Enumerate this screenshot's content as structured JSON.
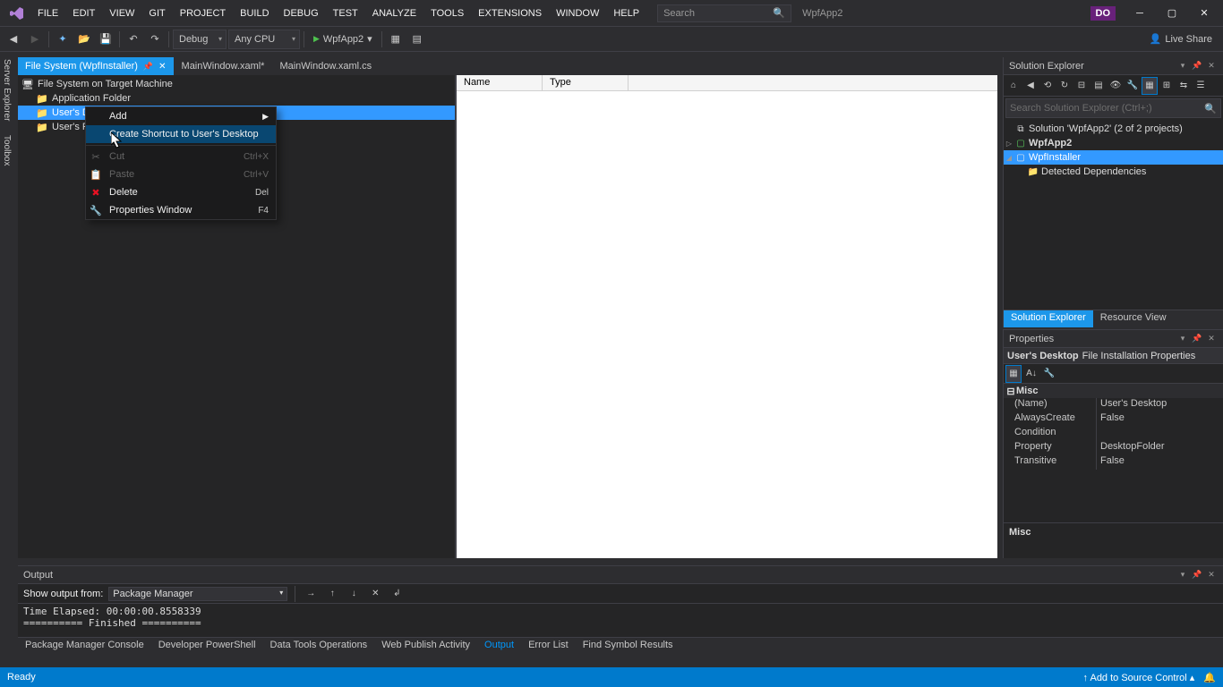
{
  "titlebar": {
    "menu": [
      "FILE",
      "EDIT",
      "VIEW",
      "GIT",
      "PROJECT",
      "BUILD",
      "DEBUG",
      "TEST",
      "ANALYZE",
      "TOOLS",
      "EXTENSIONS",
      "WINDOW",
      "HELP"
    ],
    "search_placeholder": "Search",
    "app_name": "WpfApp2",
    "user_badge": "DO"
  },
  "toolbar": {
    "config": "Debug",
    "platform": "Any CPU",
    "start": "WpfApp2",
    "live_share": "Live Share"
  },
  "tabs": [
    {
      "label": "File System (WpfInstaller)",
      "active": true,
      "pinned": true
    },
    {
      "label": "MainWindow.xaml*",
      "active": false
    },
    {
      "label": "MainWindow.xaml.cs",
      "active": false
    }
  ],
  "filesystem": {
    "root": "File System on Target Machine",
    "items": [
      {
        "label": "Application Folder",
        "indent": 1
      },
      {
        "label": "User's Desktop",
        "indent": 1,
        "selected": true
      },
      {
        "label": "User's Prog",
        "indent": 1
      }
    ]
  },
  "list_cols": [
    "Name",
    "Type"
  ],
  "context_menu": {
    "items": [
      {
        "label": "Add",
        "submenu": true
      },
      {
        "label": "Create Shortcut to User's Desktop",
        "selected": true
      },
      {
        "sep": true
      },
      {
        "label": "Cut",
        "shortcut": "Ctrl+X",
        "disabled": true,
        "icon": "✂"
      },
      {
        "label": "Paste",
        "shortcut": "Ctrl+V",
        "disabled": true,
        "icon": "📋"
      },
      {
        "label": "Delete",
        "shortcut": "Del",
        "icon": "✖",
        "icon_color": "#e81123"
      },
      {
        "label": "Properties Window",
        "shortcut": "F4",
        "icon": "🔧"
      }
    ]
  },
  "solution_explorer": {
    "title": "Solution Explorer",
    "search_placeholder": "Search Solution Explorer (Ctrl+;)",
    "nodes": [
      {
        "label": "Solution 'WpfApp2' (2 of 2 projects)",
        "indent": 0,
        "icon": "⧉"
      },
      {
        "label": "WpfApp2",
        "indent": 1,
        "bold": true,
        "exp": "▷",
        "icon": "▢"
      },
      {
        "label": "WpfInstaller",
        "indent": 1,
        "exp": "◢",
        "selected": true,
        "icon": "▢"
      },
      {
        "label": "Detected Dependencies",
        "indent": 2,
        "icon": "📁"
      }
    ],
    "bottom_tabs": [
      "Solution Explorer",
      "Resource View"
    ]
  },
  "properties": {
    "title": "Properties",
    "object_name": "User's Desktop",
    "object_type": "File Installation Properties",
    "category": "Misc",
    "rows": [
      {
        "name": "(Name)",
        "value": "User's Desktop"
      },
      {
        "name": "AlwaysCreate",
        "value": "False"
      },
      {
        "name": "Condition",
        "value": ""
      },
      {
        "name": "Property",
        "value": "DesktopFolder"
      },
      {
        "name": "Transitive",
        "value": "False"
      }
    ],
    "desc_title": "Misc"
  },
  "output": {
    "title": "Output",
    "show_from_label": "Show output from:",
    "source": "Package Manager",
    "text": "Time Elapsed: 00:00:00.8558339\n========== Finished ==========",
    "bottom_tabs": [
      "Package Manager Console",
      "Developer PowerShell",
      "Data Tools Operations",
      "Web Publish Activity",
      "Output",
      "Error List",
      "Find Symbol Results"
    ]
  },
  "status": {
    "ready": "Ready",
    "source_control": "↑ Add to Source Control ▴"
  },
  "side_tabs_left": [
    "Server Explorer",
    "Toolbox"
  ]
}
